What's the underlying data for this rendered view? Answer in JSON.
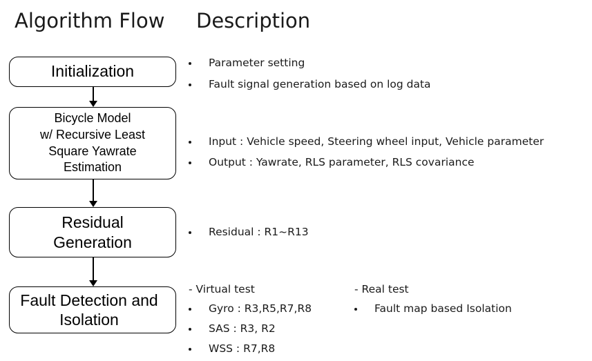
{
  "headings": {
    "flow": "Algorithm Flow",
    "description": "Description"
  },
  "flow_boxes": [
    {
      "label": "Initialization"
    },
    {
      "label": "Bicycle Model\nw/ Recursive Least\nSquare Yawrate\nEstimation"
    },
    {
      "label": "Residual\nGeneration"
    },
    {
      "label": "Fault Detection and\nIsolation"
    }
  ],
  "descriptions": {
    "step1": [
      "Parameter setting",
      "Fault signal generation based on log data"
    ],
    "step2": [
      "Input : Vehicle speed, Steering wheel input, Vehicle parameter",
      "Output : Yawrate, RLS parameter, RLS covariance"
    ],
    "step3": [
      "Residual : R1~R13"
    ],
    "step4_virtual": {
      "heading": "- Virtual test",
      "items": [
        "Gyro : R3,R5,R7,R8",
        "SAS : R3, R2",
        "WSS : R7,R8"
      ]
    },
    "step4_real": {
      "heading": "- Real test",
      "items": [
        "Fault map based Isolation"
      ]
    }
  },
  "colors": {
    "background": "#ffffff",
    "text": "#1a1a1a",
    "box_border": "#000000",
    "arrow": "#000000"
  }
}
